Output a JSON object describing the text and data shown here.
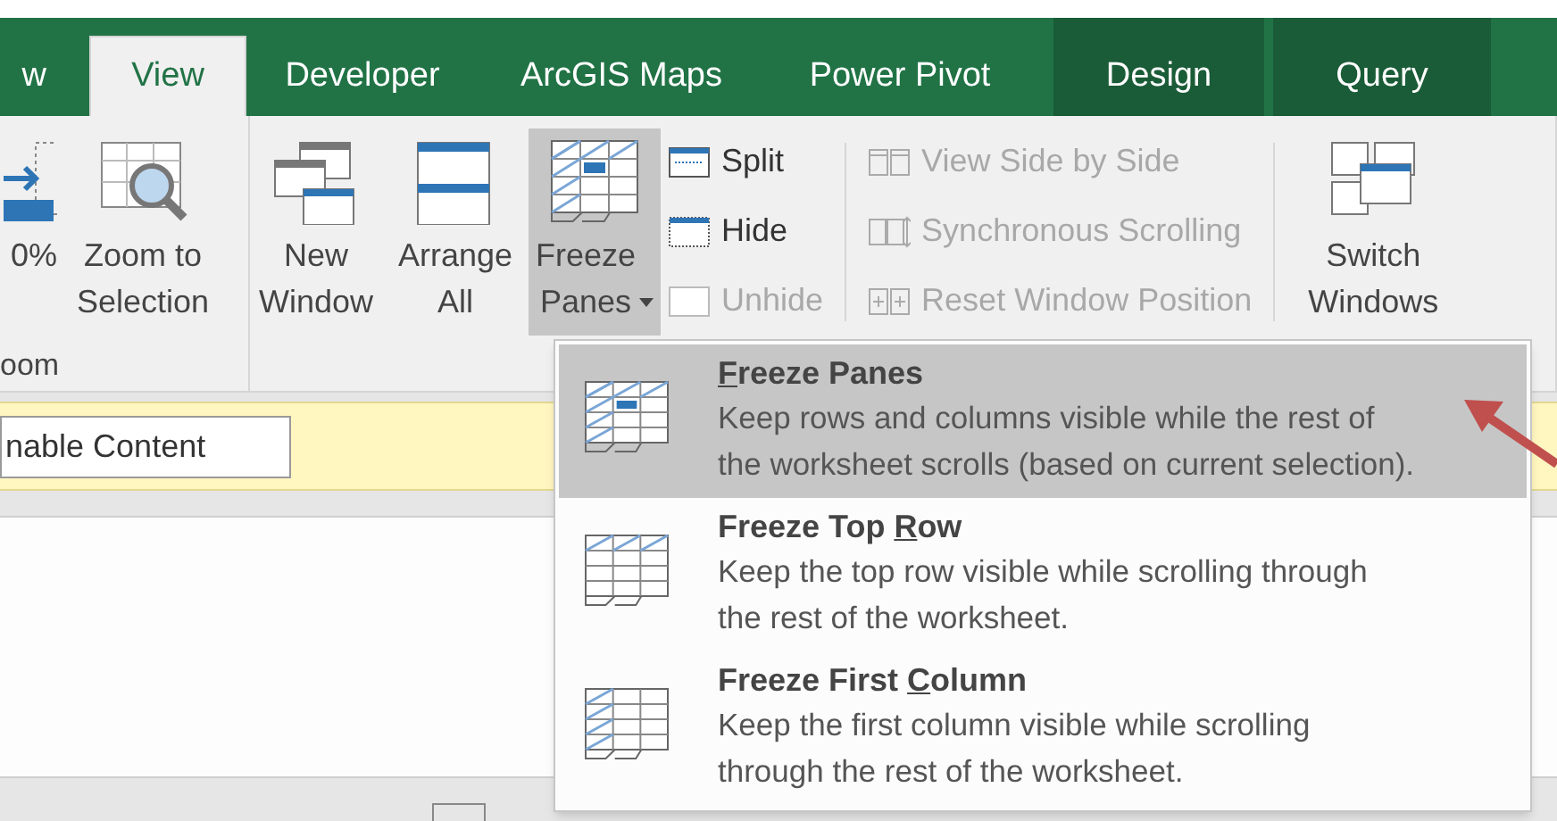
{
  "tabs": [
    {
      "label": "w",
      "selected": false,
      "contextual": false
    },
    {
      "label": "View",
      "selected": true,
      "contextual": false
    },
    {
      "label": "Developer",
      "selected": false,
      "contextual": false
    },
    {
      "label": "ArcGIS Maps",
      "selected": false,
      "contextual": false
    },
    {
      "label": "Power Pivot",
      "selected": false,
      "contextual": false
    },
    {
      "label": "Design",
      "selected": false,
      "contextual": true
    },
    {
      "label": "Query",
      "selected": false,
      "contextual": true
    }
  ],
  "ribbon": {
    "groups": [
      {
        "label": "oom",
        "controls": [
          {
            "kind": "large",
            "label": "0%",
            "pressed": false
          },
          {
            "kind": "large",
            "label": "Zoom to\nSelection",
            "pressed": false
          }
        ]
      },
      {
        "controls": [
          {
            "kind": "large",
            "label": "New\nWindow",
            "pressed": false
          },
          {
            "kind": "large",
            "label": "Arrange\nAll",
            "pressed": false
          },
          {
            "kind": "large",
            "label": "Freeze\nPanes",
            "pressed": true,
            "dropdown": true
          },
          {
            "kind": "column",
            "items": [
              {
                "label": "Split",
                "disabled": false
              },
              {
                "label": "Hide",
                "disabled": false
              },
              {
                "label": "Unhide",
                "disabled": true
              }
            ]
          },
          {
            "kind": "separator"
          },
          {
            "kind": "column",
            "items": [
              {
                "label": "View Side by Side",
                "disabled": true
              },
              {
                "label": "Synchronous Scrolling",
                "disabled": true
              },
              {
                "label": "Reset Window Position",
                "disabled": true
              }
            ]
          },
          {
            "kind": "separator"
          },
          {
            "kind": "large",
            "label": "Switch\nWindows",
            "pressed": false
          }
        ]
      }
    ]
  },
  "message_bar": {
    "button": "nable Content"
  },
  "menu": {
    "items": [
      {
        "label_parts": {
          "key": "F",
          "after": "reeze Panes"
        },
        "description": "Keep rows and columns visible while the rest of\nthe worksheet scrolls (based on current selection).",
        "selected": true
      },
      {
        "label_parts": {
          "before": "Freeze Top ",
          "key": "R",
          "after": "ow"
        },
        "description": "Keep the top row visible while scrolling through\nthe rest of the worksheet.",
        "selected": false
      },
      {
        "label_parts": {
          "before": "Freeze First ",
          "key": "C",
          "after": "olumn"
        },
        "description": "Keep the first column visible while scrolling\nthrough the rest of the worksheet.",
        "selected": false
      }
    ]
  }
}
